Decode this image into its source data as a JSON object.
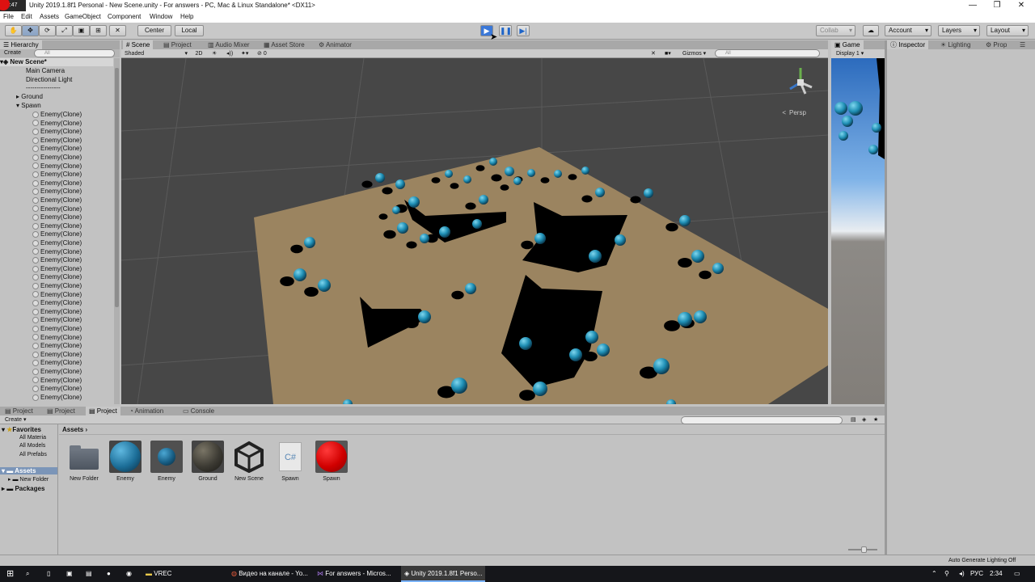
{
  "window": {
    "rec_label": "00:47",
    "title": "Unity 2019.1.8f1 Personal - New Scene.unity - For answers - PC, Mac & Linux Standalone* <DX11>"
  },
  "menu": [
    "File",
    "Edit",
    "Assets",
    "GameObject",
    "Component",
    "Window",
    "Help"
  ],
  "toolbar": {
    "pivot": "Center",
    "space": "Local",
    "collab": "Collab",
    "account": "Account",
    "layers": "Layers",
    "layout": "Layout"
  },
  "hierarchy": {
    "tab": "Hierarchy",
    "create": "Create",
    "search_placeholder": "All",
    "scene_name": "New Scene*",
    "items": [
      "Main Camera",
      "Directional Light",
      "----------------",
      "Ground",
      "Spawn"
    ],
    "clone_label": "Enemy(Clone)"
  },
  "scene_tabs": [
    "Scene",
    "Project",
    "Audio Mixer",
    "Asset Store",
    "Animator"
  ],
  "scene_bar": {
    "shading": "Shaded",
    "mode_2d": "2D",
    "hidden_count": "0",
    "gizmos": "Gizmos",
    "search_placeholder": "All",
    "persp": "Persp"
  },
  "game": {
    "tab": "Game",
    "display": "Display 1"
  },
  "right_tabs": [
    "Inspector",
    "Lighting",
    "Prop"
  ],
  "bottom_tabs": [
    "Project",
    "Project",
    "Project",
    "Animation",
    "Console"
  ],
  "project": {
    "create": "Create",
    "breadcrumb": "Assets",
    "favorites": "Favorites",
    "fav_items": [
      "All Materia",
      "All Models",
      "All Prefabs"
    ],
    "assets_root": "Assets",
    "folder_items": [
      "New Folder"
    ],
    "packages": "Packages",
    "assets": [
      {
        "name": "New Folder",
        "kind": "folder"
      },
      {
        "name": "Enemy",
        "kind": "material"
      },
      {
        "name": "Enemy",
        "kind": "prefab"
      },
      {
        "name": "Ground",
        "kind": "material-dark"
      },
      {
        "name": "New Scene",
        "kind": "unity"
      },
      {
        "name": "Spawn",
        "kind": "script"
      },
      {
        "name": "Spawn",
        "kind": "material-red"
      }
    ]
  },
  "status": "Auto Generate Lighting Off",
  "taskbar": {
    "apps": [
      "VREC",
      "Видео на канале - Yo...",
      "For answers - Micros...",
      "Unity 2019.1.8f1 Perso..."
    ],
    "lang": "РУС",
    "time": "2:34"
  },
  "colors": {
    "ground": "#9b8460",
    "sphere": "#2aa3c7",
    "play_active": "#3b78d8",
    "sky_top": "#2c6bbd"
  }
}
